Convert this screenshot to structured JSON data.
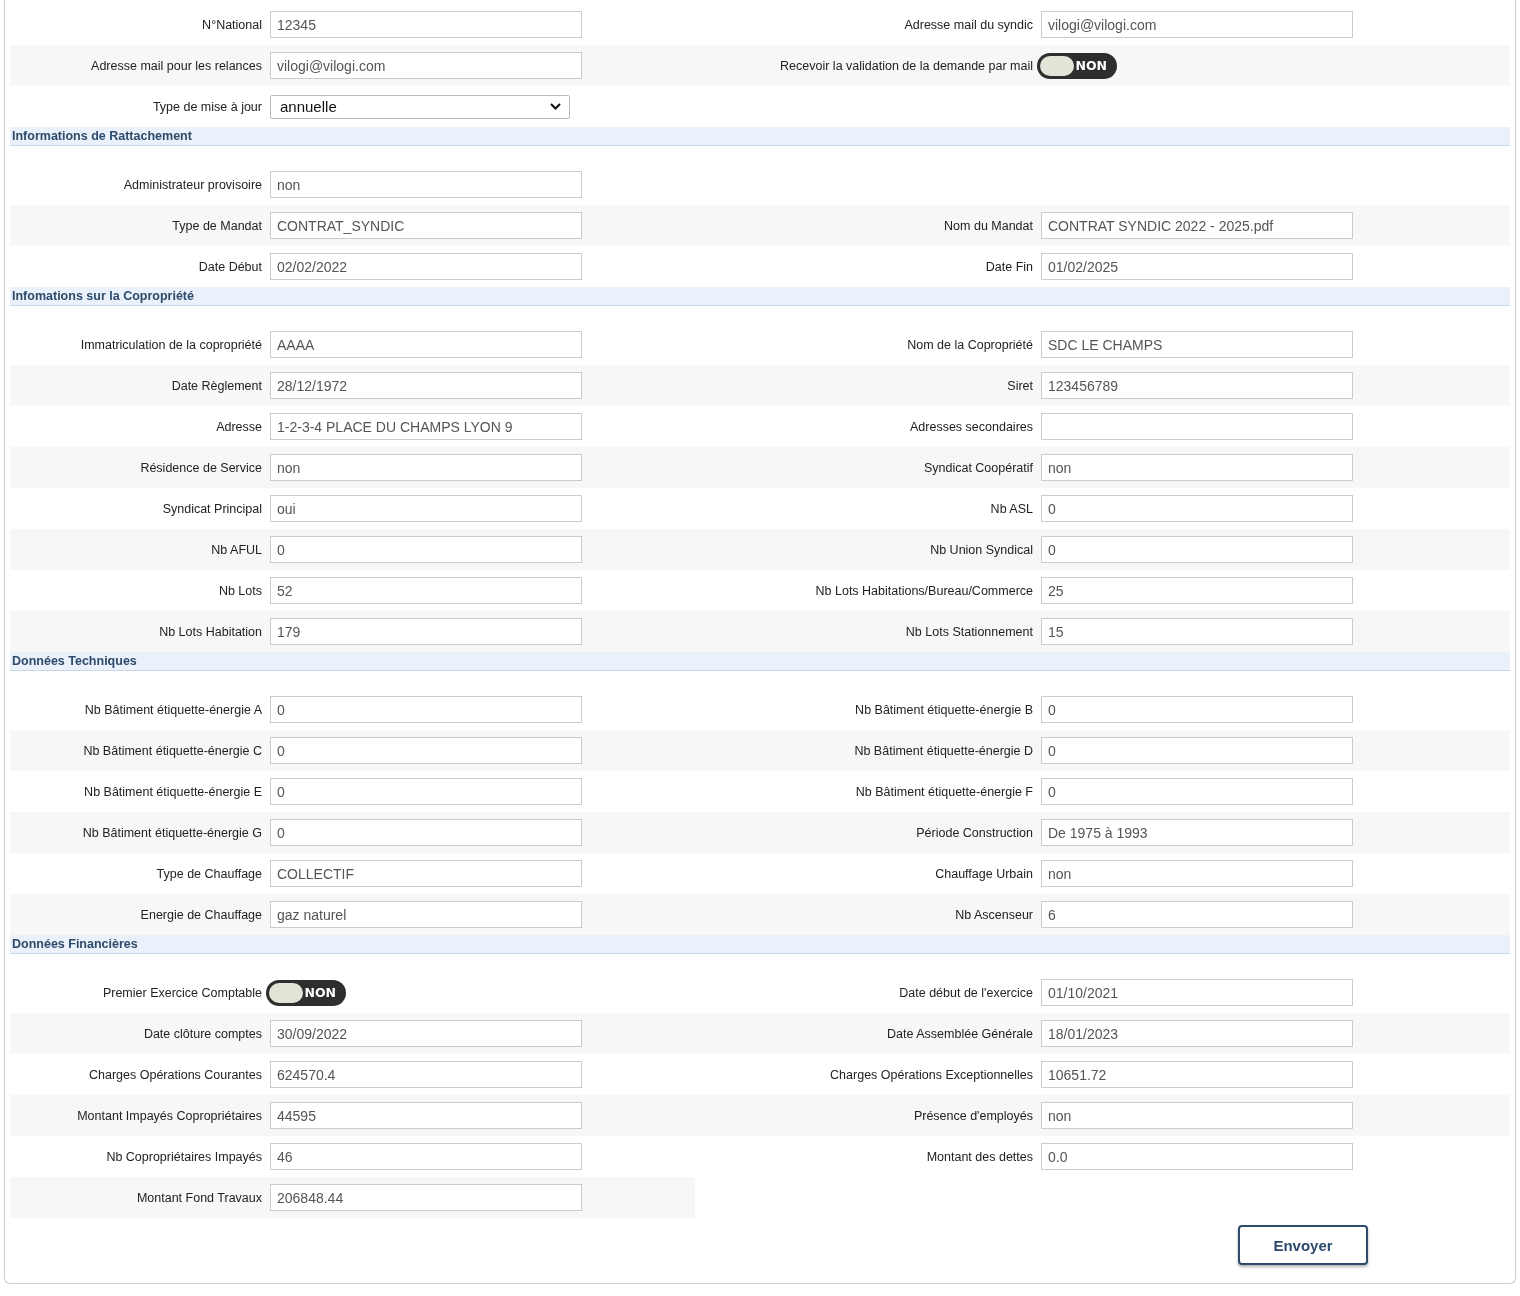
{
  "sections": [
    {
      "rows": [
        {
          "cells": [
            {
              "kind": "input",
              "label": "N°National",
              "value": "12345"
            },
            {
              "kind": "input",
              "label": "Adresse mail du syndic",
              "value": "vilogi@vilogi.com"
            }
          ]
        },
        {
          "cells": [
            {
              "kind": "input",
              "label": "Adresse mail pour les relances",
              "value": "vilogi@vilogi.com"
            },
            {
              "kind": "toggle",
              "label": "Recevoir la validation de la demande par mail",
              "on": false,
              "text": "NON"
            }
          ]
        },
        {
          "cells": [
            {
              "kind": "select",
              "label": "Type de mise à jour",
              "value": "annuelle"
            }
          ]
        }
      ]
    },
    {
      "title": "Informations de Rattachement",
      "rows": [
        {
          "cells": [
            {
              "kind": "input",
              "label": "Administrateur provisoire",
              "value": "non"
            }
          ]
        },
        {
          "cells": [
            {
              "kind": "input",
              "label": "Type de Mandat",
              "value": "CONTRAT_SYNDIC"
            },
            {
              "kind": "input",
              "label": "Nom du Mandat",
              "value": "CONTRAT SYNDIC 2022 - 2025.pdf"
            }
          ]
        },
        {
          "cells": [
            {
              "kind": "input",
              "label": "Date Début",
              "value": "02/02/2022"
            },
            {
              "kind": "input",
              "label": "Date Fin",
              "value": "01/02/2025"
            }
          ]
        }
      ]
    },
    {
      "title": "Infomations sur la Copropriété",
      "rows": [
        {
          "cells": [
            {
              "kind": "input",
              "label": "Immatriculation de la copropriété",
              "value": "AAAA"
            },
            {
              "kind": "input",
              "label": "Nom de la Copropriété",
              "value": "SDC LE CHAMPS"
            }
          ]
        },
        {
          "cells": [
            {
              "kind": "input",
              "label": "Date Règlement",
              "value": "28/12/1972"
            },
            {
              "kind": "input",
              "label": "Siret",
              "value": "123456789"
            }
          ]
        },
        {
          "cells": [
            {
              "kind": "input",
              "label": "Adresse",
              "value": "1-2-3-4 PLACE DU CHAMPS LYON 9"
            },
            {
              "kind": "input",
              "label": "Adresses secondaires"
            }
          ]
        },
        {
          "cells": [
            {
              "kind": "input",
              "label": "Résidence de Service",
              "value": "non"
            },
            {
              "kind": "input",
              "label": "Syndicat Coopératif",
              "value": "non"
            }
          ]
        },
        {
          "cells": [
            {
              "kind": "input",
              "label": "Syndicat Principal",
              "value": "oui"
            },
            {
              "kind": "input",
              "label": "Nb ASL",
              "value": "0"
            }
          ]
        },
        {
          "cells": [
            {
              "kind": "input",
              "label": "Nb AFUL",
              "value": "0"
            },
            {
              "kind": "input",
              "label": "Nb Union Syndical",
              "value": "0"
            }
          ]
        },
        {
          "cells": [
            {
              "kind": "input",
              "label": "Nb Lots",
              "value": "52"
            },
            {
              "kind": "input",
              "label": "Nb Lots Habitations/Bureau/Commerce",
              "value": "25"
            }
          ]
        },
        {
          "cells": [
            {
              "kind": "input",
              "label": "Nb Lots Habitation",
              "value": "179"
            },
            {
              "kind": "input",
              "label": "Nb Lots Stationnement",
              "value": "15"
            }
          ]
        }
      ]
    },
    {
      "title": "Données Techniques",
      "rows": [
        {
          "cells": [
            {
              "kind": "input",
              "label": "Nb Bâtiment étiquette-énergie A",
              "value": "0"
            },
            {
              "kind": "input",
              "label": "Nb Bâtiment étiquette-énergie B",
              "value": "0"
            }
          ]
        },
        {
          "cells": [
            {
              "kind": "input",
              "label": "Nb Bâtiment étiquette-énergie C",
              "value": "0"
            },
            {
              "kind": "input",
              "label": "Nb Bâtiment étiquette-énergie D",
              "value": "0"
            }
          ]
        },
        {
          "cells": [
            {
              "kind": "input",
              "label": "Nb Bâtiment étiquette-énergie E",
              "value": "0"
            },
            {
              "kind": "input",
              "label": "Nb Bâtiment étiquette-énergie F",
              "value": "0"
            }
          ]
        },
        {
          "cells": [
            {
              "kind": "input",
              "label": "Nb Bâtiment étiquette-énergie G",
              "value": "0"
            },
            {
              "kind": "input",
              "label": "Période Construction",
              "value": "De 1975 à 1993"
            }
          ]
        },
        {
          "cells": [
            {
              "kind": "input",
              "label": "Type de Chauffage",
              "value": "COLLECTIF"
            },
            {
              "kind": "input",
              "label": "Chauffage Urbain",
              "value": "non"
            }
          ]
        },
        {
          "cells": [
            {
              "kind": "input",
              "label": "Energie de Chauffage",
              "value": "gaz naturel"
            },
            {
              "kind": "input",
              "label": "Nb Ascenseur",
              "value": "6"
            }
          ]
        }
      ]
    },
    {
      "title": "Données Financières",
      "rows": [
        {
          "cells": [
            {
              "kind": "toggle",
              "label": "Premier Exercice Comptable",
              "on": false,
              "text": "NON"
            },
            {
              "kind": "input",
              "label": "Date début de l'exercice",
              "value": "01/10/2021"
            }
          ]
        },
        {
          "cells": [
            {
              "kind": "input",
              "label": "Date clôture comptes",
              "value": "30/09/2022"
            },
            {
              "kind": "input",
              "label": "Date Assemblée Générale",
              "value": "18/01/2023"
            }
          ]
        },
        {
          "cells": [
            {
              "kind": "input",
              "label": "Charges Opérations Courantes",
              "value": "624570.4"
            },
            {
              "kind": "input",
              "label": "Charges Opérations Exceptionnelles",
              "value": "10651.72"
            }
          ]
        },
        {
          "cells": [
            {
              "kind": "input",
              "label": "Montant Impayés Copropriétaires",
              "value": "44595"
            },
            {
              "kind": "input",
              "label": "Présence d'employés",
              "value": "non"
            }
          ]
        },
        {
          "cells": [
            {
              "kind": "input",
              "label": "Nb Copropriétaires Impayés",
              "value": "46"
            },
            {
              "kind": "input",
              "label": "Montant des dettes",
              "value": "0.0"
            }
          ]
        },
        {
          "cells": [
            {
              "kind": "input",
              "label": "Montant Fond Travaux",
              "value": "206848.44"
            }
          ]
        }
      ]
    }
  ],
  "submit": "Envoyer"
}
